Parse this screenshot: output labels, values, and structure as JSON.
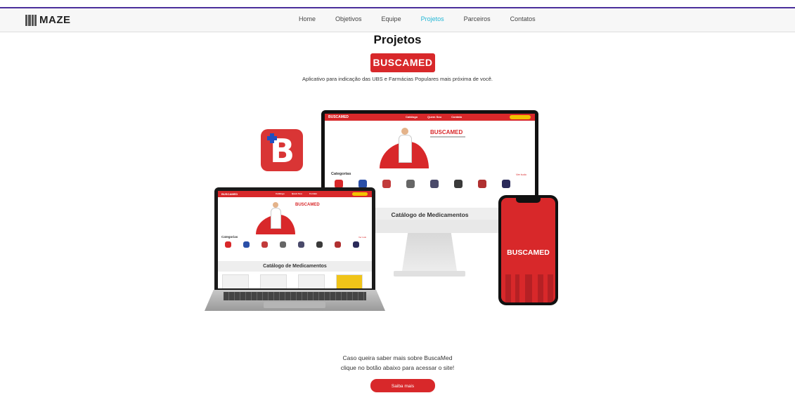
{
  "nav": {
    "logo": "MAZE",
    "items": [
      {
        "label": "Home",
        "active": false
      },
      {
        "label": "Objetivos",
        "active": false
      },
      {
        "label": "Equipe",
        "active": false
      },
      {
        "label": "Projetos",
        "active": true
      },
      {
        "label": "Parceiros",
        "active": false
      },
      {
        "label": "Contatos",
        "active": false
      }
    ]
  },
  "colors": {
    "brand": "#d8282a",
    "active_link": "#23b7d6",
    "top_bar": "#4b2f9b"
  },
  "page": {
    "title": "Projetos",
    "project_name": "BUSCAMED",
    "description": "Aplicativo para indicação das UBS e Farmácias Populares mais próxima de você."
  },
  "mockup": {
    "site_logo": "BUSCAMED",
    "site_links": [
      "Catálogo",
      "Quem Sou",
      "Contato"
    ],
    "hero_title": "BUSCAMED",
    "categories_title": "Categorias",
    "see_all": "Ver tudo",
    "catalog_title": "Catálogo de Medicamentos",
    "phone_brand": "BUSCAMED",
    "app_icon_letter": "B"
  },
  "footer": {
    "line1": "Caso queira saber mais sobre BuscaMed",
    "line2": "clique no botão abaixo para acessar o site!",
    "cta": "Saiba mais"
  }
}
